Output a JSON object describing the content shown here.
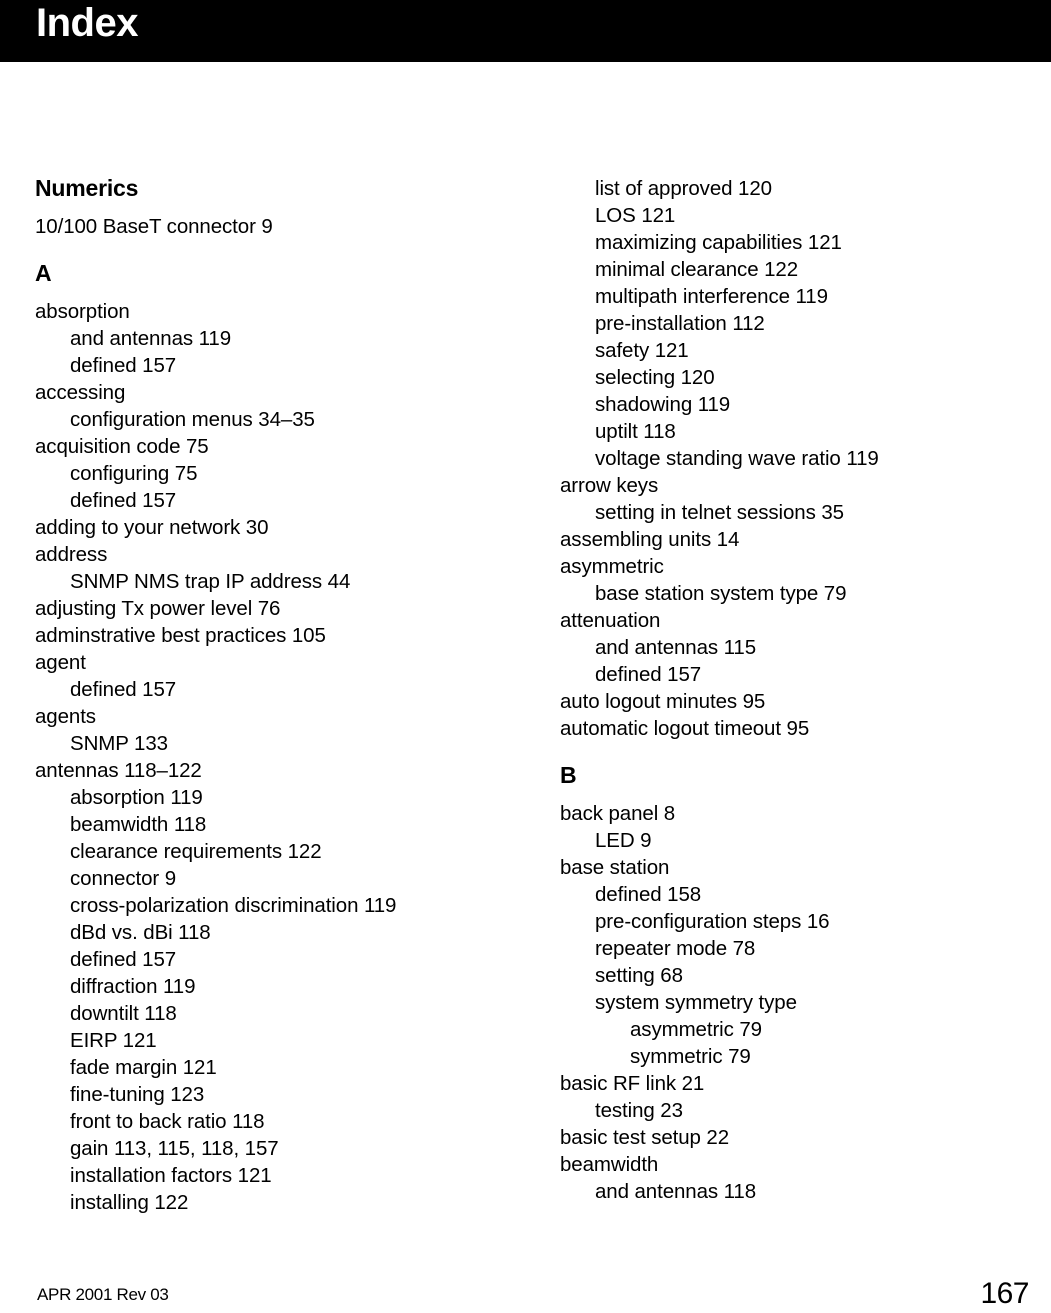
{
  "header": {
    "title": "Index"
  },
  "footer": {
    "revision": "APR 2001 Rev 03",
    "page_number": "167"
  },
  "columns": {
    "left": {
      "sections": [
        {
          "heading": "Numerics",
          "entries": [
            {
              "level": 1,
              "text": "10/100 BaseT connector 9"
            }
          ]
        },
        {
          "heading": "A",
          "entries": [
            {
              "level": 1,
              "text": "absorption"
            },
            {
              "level": 2,
              "text": "and antennas 119"
            },
            {
              "level": 2,
              "text": "defined 157"
            },
            {
              "level": 1,
              "text": "accessing"
            },
            {
              "level": 2,
              "text": "configuration menus 34–35"
            },
            {
              "level": 1,
              "text": "acquisition code 75"
            },
            {
              "level": 2,
              "text": "configuring 75"
            },
            {
              "level": 2,
              "text": "defined 157"
            },
            {
              "level": 1,
              "text": "adding to your network 30"
            },
            {
              "level": 1,
              "text": "address"
            },
            {
              "level": 2,
              "text": "SNMP NMS trap IP address 44"
            },
            {
              "level": 1,
              "text": "adjusting Tx power level 76"
            },
            {
              "level": 1,
              "text": "adminstrative best practices 105"
            },
            {
              "level": 1,
              "text": "agent"
            },
            {
              "level": 2,
              "text": "defined 157"
            },
            {
              "level": 1,
              "text": "agents"
            },
            {
              "level": 2,
              "text": "SNMP 133"
            },
            {
              "level": 1,
              "text": "antennas 118–122"
            },
            {
              "level": 2,
              "text": "absorption 119"
            },
            {
              "level": 2,
              "text": "beamwidth 118"
            },
            {
              "level": 2,
              "text": "clearance requirements 122"
            },
            {
              "level": 2,
              "text": "connector 9"
            },
            {
              "level": 2,
              "text": "cross-polarization discrimination 119"
            },
            {
              "level": 2,
              "text": "dBd vs. dBi 118"
            },
            {
              "level": 2,
              "text": "defined 157"
            },
            {
              "level": 2,
              "text": "diffraction 119"
            },
            {
              "level": 2,
              "text": "downtilt 118"
            },
            {
              "level": 2,
              "text": "EIRP 121"
            },
            {
              "level": 2,
              "text": "fade margin 121"
            },
            {
              "level": 2,
              "text": "fine-tuning 123"
            },
            {
              "level": 2,
              "text": "front to back ratio 118"
            },
            {
              "level": 2,
              "text": "gain 113, 115, 118, 157"
            },
            {
              "level": 2,
              "text": "installation factors 121"
            },
            {
              "level": 2,
              "text": "installing 122"
            }
          ]
        }
      ]
    },
    "right": {
      "continuation": [
        {
          "level": 2,
          "text": "list of approved 120"
        },
        {
          "level": 2,
          "text": "LOS 121"
        },
        {
          "level": 2,
          "text": "maximizing capabilities 121"
        },
        {
          "level": 2,
          "text": "minimal clearance 122"
        },
        {
          "level": 2,
          "text": "multipath interference 119"
        },
        {
          "level": 2,
          "text": "pre-installation 112"
        },
        {
          "level": 2,
          "text": "safety 121"
        },
        {
          "level": 2,
          "text": "selecting 120"
        },
        {
          "level": 2,
          "text": "shadowing 119"
        },
        {
          "level": 2,
          "text": "uptilt 118"
        },
        {
          "level": 2,
          "text": "voltage standing wave ratio 119"
        },
        {
          "level": 1,
          "text": "arrow keys"
        },
        {
          "level": 2,
          "text": "setting in telnet sessions 35"
        },
        {
          "level": 1,
          "text": "assembling units 14"
        },
        {
          "level": 1,
          "text": "asymmetric"
        },
        {
          "level": 2,
          "text": "base station system type 79"
        },
        {
          "level": 1,
          "text": "attenuation"
        },
        {
          "level": 2,
          "text": "and antennas 115"
        },
        {
          "level": 2,
          "text": "defined 157"
        },
        {
          "level": 1,
          "text": "auto logout minutes 95"
        },
        {
          "level": 1,
          "text": "automatic logout timeout 95"
        }
      ],
      "sections": [
        {
          "heading": "B",
          "entries": [
            {
              "level": 1,
              "text": "back panel 8"
            },
            {
              "level": 2,
              "text": "LED 9"
            },
            {
              "level": 1,
              "text": "base station"
            },
            {
              "level": 2,
              "text": "defined 158"
            },
            {
              "level": 2,
              "text": "pre-configuration steps 16"
            },
            {
              "level": 2,
              "text": "repeater mode 78"
            },
            {
              "level": 2,
              "text": "setting 68"
            },
            {
              "level": 2,
              "text": "system symmetry type"
            },
            {
              "level": 3,
              "text": "asymmetric 79"
            },
            {
              "level": 3,
              "text": "symmetric 79"
            },
            {
              "level": 1,
              "text": "basic RF link 21"
            },
            {
              "level": 2,
              "text": "testing 23"
            },
            {
              "level": 1,
              "text": "basic test setup 22"
            },
            {
              "level": 1,
              "text": "beamwidth"
            },
            {
              "level": 2,
              "text": "and antennas 118"
            }
          ]
        }
      ]
    }
  }
}
